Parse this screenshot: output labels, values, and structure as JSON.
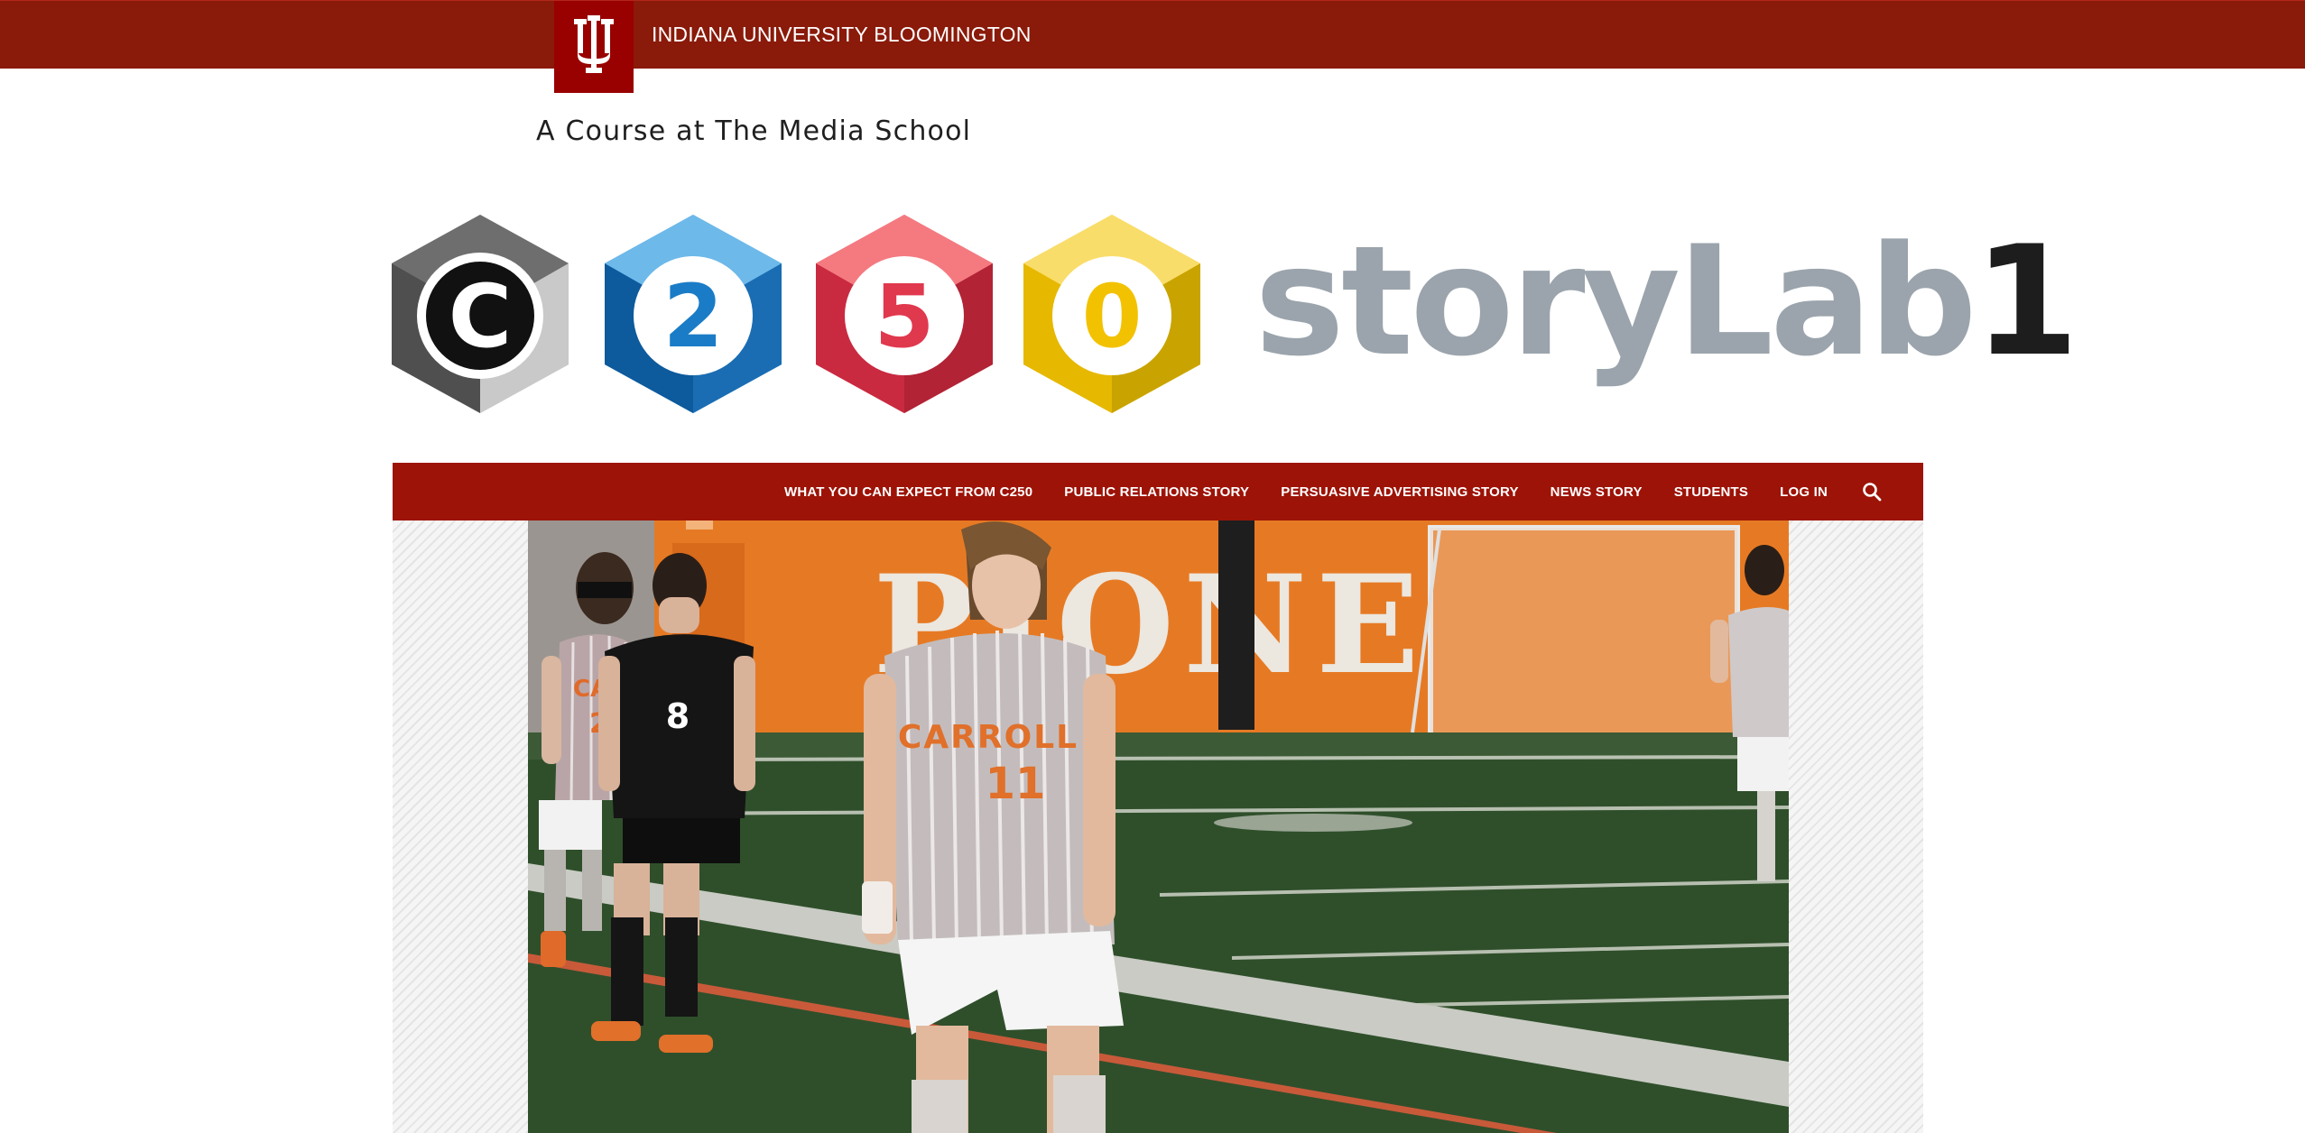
{
  "header": {
    "university": "INDIANA UNIVERSITY BLOOMINGTON",
    "trident_icon": "iu-trident-icon"
  },
  "site": {
    "tagline": "A Course at The Media School",
    "logo_tiles": [
      "C",
      "2",
      "5",
      "0"
    ],
    "brand_main": "storyLab",
    "brand_suffix": "1",
    "colors": {
      "iu_crimson": "#990000",
      "bar": "#8a1a0a",
      "nav": "#9d1307",
      "tile_c": "#555555",
      "tile_2": "#1a7cc6",
      "tile_5": "#e0384d",
      "tile_0": "#f2c200",
      "brand_text": "#9ba4ac"
    }
  },
  "nav": {
    "items": [
      "WHAT YOU CAN EXPECT FROM C250",
      "PUBLIC RELATIONS STORY",
      "PERSUASIVE ADVERTISING STORY",
      "NEWS STORY",
      "STUDENTS",
      "LOG IN"
    ],
    "search_icon": "search-icon"
  },
  "hero": {
    "wall_text": "PIONE",
    "jersey_main": "CARROLL",
    "jersey_main_number": "11",
    "jersey_left_number": "8",
    "jersey_far_left": "CAR",
    "jersey_far_left_number": "2"
  }
}
